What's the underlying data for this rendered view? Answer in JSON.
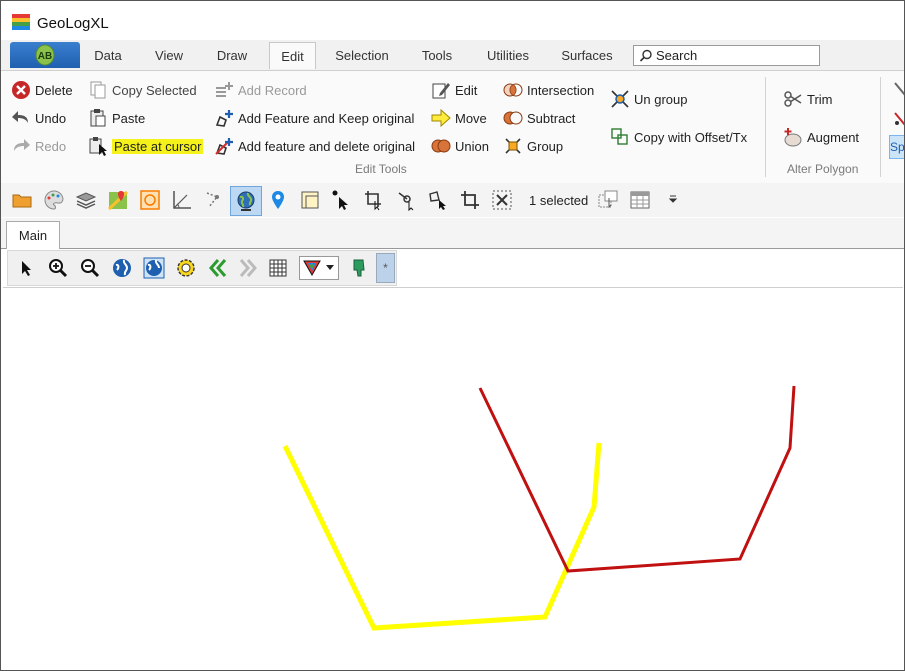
{
  "app": {
    "title": "GeoLogXL",
    "home_badge": "AB"
  },
  "tabs": [
    "Data",
    "View",
    "Draw",
    "Edit",
    "Selection",
    "Tools",
    "Utilities",
    "Surfaces"
  ],
  "active_tab": "Edit",
  "search": {
    "placeholder": "Search"
  },
  "ribbon": {
    "col1": [
      "Delete",
      "Undo",
      "Redo"
    ],
    "col2": [
      "Copy Selected",
      "Paste",
      "Paste at cursor"
    ],
    "col3": [
      "Add Record",
      "Add Feature and Keep original",
      "Add feature and delete original"
    ],
    "col4": [
      "Edit",
      "Move",
      "Union"
    ],
    "col5": [
      "Intersection",
      "Subtract",
      "Group"
    ],
    "col6": [
      "Un group",
      "Copy with Offset/Tx"
    ],
    "col7": [
      "Trim",
      "Augment"
    ],
    "group_labels": {
      "edit_tools": "Edit Tools",
      "alter_polygon": "Alter Polygon"
    },
    "cut_off_button": "Sp"
  },
  "toolbar": {
    "selected_count": "1 selected"
  },
  "document_tabs": [
    "Main"
  ],
  "map_toolbar": {
    "layer_button": "*"
  },
  "colors": {
    "yellow_line": "#ffff00",
    "red_line": "#c01010",
    "highlight": "#f4f21a",
    "accent": "#1f5fb0"
  }
}
